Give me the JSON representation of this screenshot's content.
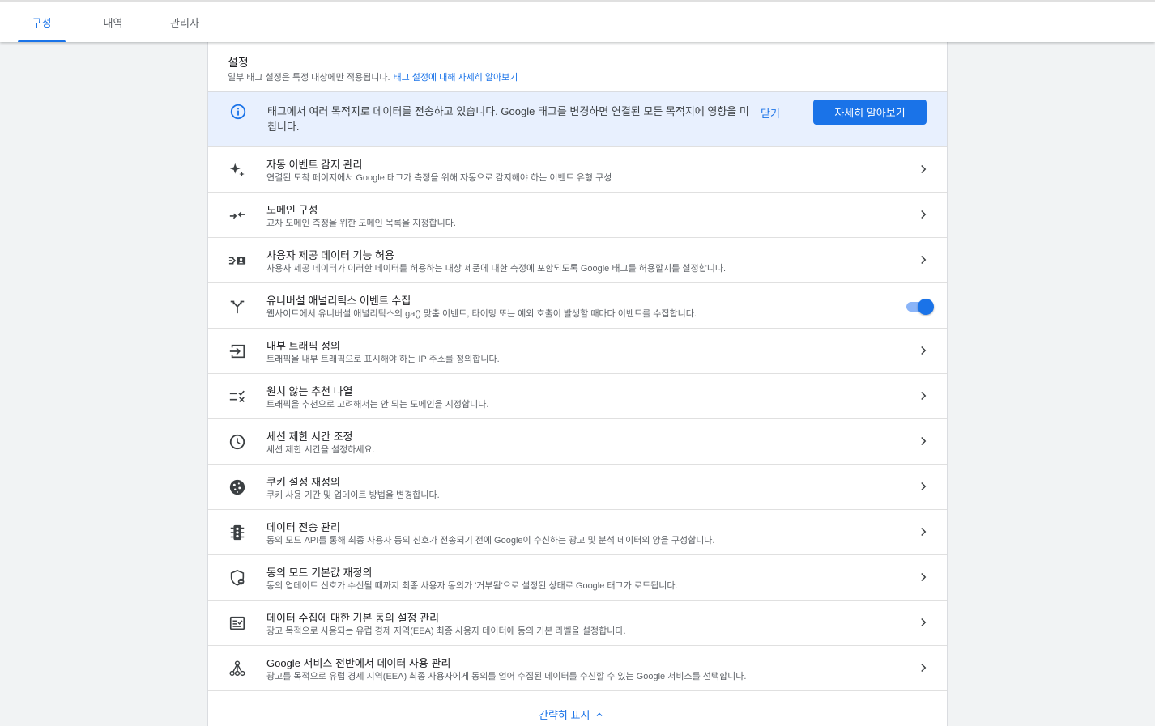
{
  "tabs": [
    {
      "label": "구성",
      "active": true
    },
    {
      "label": "내역",
      "active": false
    },
    {
      "label": "관리자",
      "active": false
    }
  ],
  "settings": {
    "title": "설정",
    "subtitle": "일부 태그 설정은 특정 대상에만 적용됩니다.",
    "learn_link": "태그 설정에 대해 자세히 알아보기"
  },
  "banner": {
    "icon": "info-icon",
    "text": "태그에서 여러 목적지로 데이터를 전송하고 있습니다. Google 태그를 변경하면 연결된 모든 목적지에 영향을 미칩니다.",
    "close_label": "닫기",
    "action_label": "자세히 알아보기"
  },
  "rows": [
    {
      "icon": "sparkle-icon",
      "title": "자동 이벤트 감지 관리",
      "desc": "연결된 도착 페이지에서 Google 태그가 측정을 위해 자동으로 감지해야 하는 이벤트 유형 구성",
      "control": "chevron"
    },
    {
      "icon": "merge-arrows-icon",
      "title": "도메인 구성",
      "desc": "교차 도메인 측정을 위한 도메인 목록을 지정합니다.",
      "control": "chevron"
    },
    {
      "icon": "user-data-icon",
      "title": "사용자 제공 데이터 기능 허용",
      "desc": "사용자 제공 데이터가 이러한 데이터를 허용하는 대상 제품에 대한 측정에 포함되도록 Google 태그를 허용할지를 설정합니다.",
      "control": "chevron"
    },
    {
      "icon": "fork-arrow-icon",
      "title": "유니버설 애널리틱스 이벤트 수집",
      "desc": "웹사이트에서 유니버설 애널리틱스의 ga() 맞춤 이벤트, 타이밍 또는 예외 호출이 발생할 때마다 이벤트를 수집합니다.",
      "control": "toggle",
      "toggle_on": true
    },
    {
      "icon": "login-arrow-icon",
      "title": "내부 트래픽 정의",
      "desc": "트래픽을 내부 트래픽으로 표시해야 하는 IP 주소를 정의합니다.",
      "control": "chevron"
    },
    {
      "icon": "checklist-x-icon",
      "title": "원치 않는 추천 나열",
      "desc": "트래픽을 추천으로 고려해서는 안 되는 도메인을 지정합니다.",
      "control": "chevron"
    },
    {
      "icon": "clock-icon",
      "title": "세션 제한 시간 조정",
      "desc": "세션 제한 시간을 설정하세요.",
      "control": "chevron"
    },
    {
      "icon": "cookie-icon",
      "title": "쿠키 설정 재정의",
      "desc": "쿠키 사용 기간 및 업데이트 방법을 변경합니다.",
      "control": "chevron"
    },
    {
      "icon": "traffic-light-icon",
      "title": "데이터 전송 관리",
      "desc": "동의 모드 API를 통해 최종 사용자 동의 신호가 전송되기 전에 Google이 수신하는 광고 및 분석 데이터의 양을 구성합니다.",
      "control": "chevron"
    },
    {
      "icon": "shield-minus-icon",
      "title": "동의 모드 기본값 재정의",
      "desc": "동의 업데이트 신호가 수신될 때까지 최종 사용자 동의가 '거부됨'으로 설정된 상태로 Google 태그가 로드됩니다.",
      "control": "chevron"
    },
    {
      "icon": "checklist-box-icon",
      "title": "데이터 수집에 대한 기본 동의 설정 관리",
      "desc": "광고 목적으로 사용되는 유럽 경제 지역(EEA) 최종 사용자 데이터에 동의 기본 라벨을 설정합니다.",
      "control": "chevron"
    },
    {
      "icon": "hub-icon",
      "title": "Google 서비스 전반에서 데이터 사용 관리",
      "desc": "광고를 목적으로 유럽 경제 지역(EEA) 최종 사용자에게 동의를 얻어 수집된 데이터를 수신할 수 있는 Google 서비스를 선택합니다.",
      "control": "chevron"
    }
  ],
  "footer": {
    "collapse_label": "간략히 표시"
  },
  "colors": {
    "accent": "#1a73e8",
    "banner_bg": "#e8f0fe",
    "icon": "#3c4043",
    "page_bg": "#f1f3f4"
  }
}
